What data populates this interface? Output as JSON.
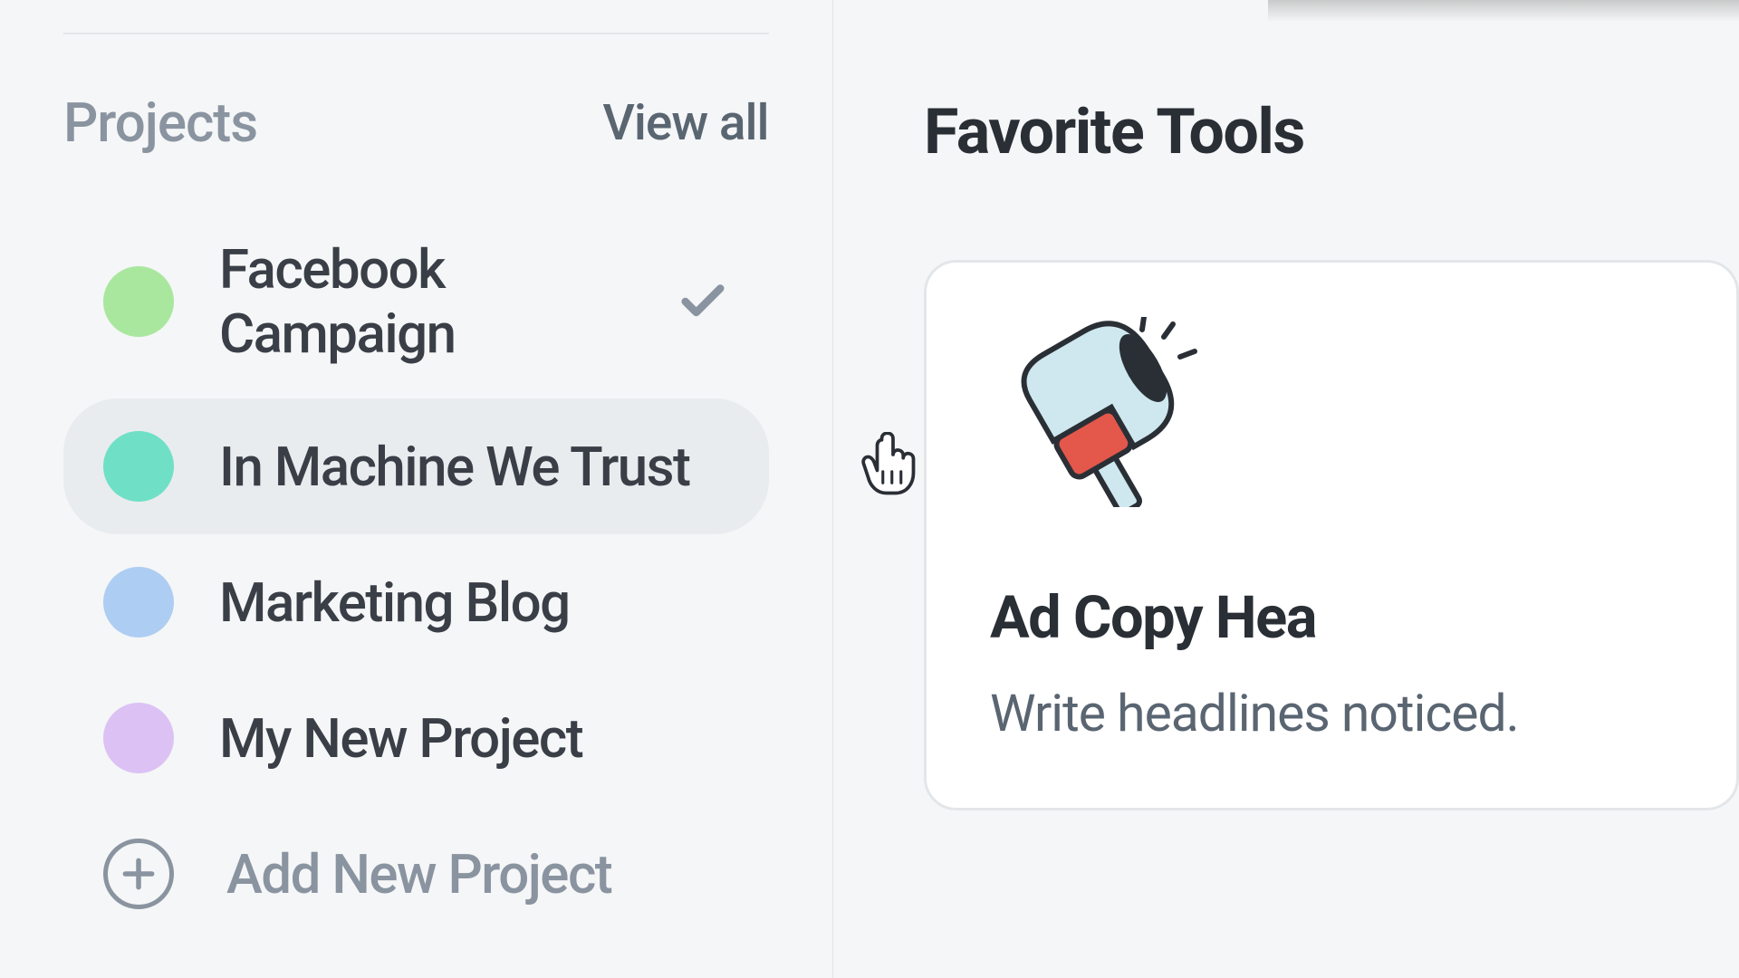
{
  "sidebar": {
    "section_title": "Projects",
    "view_all": "View all",
    "projects": [
      {
        "label": "Facebook Campaign",
        "color": "#a9e79f",
        "selected": true,
        "hovered": false
      },
      {
        "label": "In Machine We Trust",
        "color": "#6fe0c6",
        "selected": false,
        "hovered": true
      },
      {
        "label": "Marketing Blog",
        "color": "#aecdf2",
        "selected": false,
        "hovered": false
      },
      {
        "label": "My New Project",
        "color": "#dcc2f4",
        "selected": false,
        "hovered": false
      }
    ],
    "add_new": "Add New Project"
  },
  "main": {
    "favorites_title": "Favorite Tools",
    "tool": {
      "name": "Ad Copy Hea",
      "description": "Write headlines noticed.",
      "icon": "megaphone-icon"
    }
  }
}
